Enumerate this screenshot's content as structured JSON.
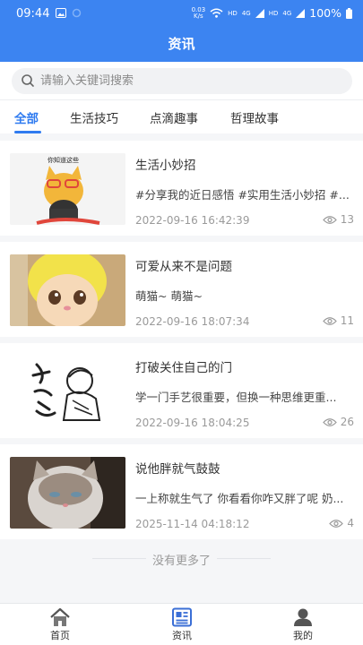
{
  "status_bar": {
    "time": "09:44",
    "speed": "0.03\nK/s",
    "network_a": "HD",
    "network_b": "4G",
    "network_c": "HD",
    "network_d": "4G",
    "battery": "100%"
  },
  "header": {
    "title": "资讯"
  },
  "search": {
    "placeholder": "请输入关键词搜索"
  },
  "tabs": [
    {
      "label": "全部",
      "active": true
    },
    {
      "label": "生活技巧",
      "active": false
    },
    {
      "label": "点滴趣事",
      "active": false
    },
    {
      "label": "哲理故事",
      "active": false
    }
  ],
  "articles": [
    {
      "title": "生活小妙招",
      "description": "#分享我的近日感悟 #实用生活小妙招 #...",
      "date": "2022-09-16 16:42:39",
      "views": "13",
      "thumb_text": "你知道这些"
    },
    {
      "title": "可爱从来不是问题",
      "description": "萌猫~ 萌猫~",
      "date": "2022-09-16 18:07:34",
      "views": "11"
    },
    {
      "title": "打破关住自己的门",
      "description": "学一门手艺很重要，但换一种思维更重...",
      "date": "2022-09-16 18:04:25",
      "views": "26"
    },
    {
      "title": "说他胖就气鼓鼓",
      "description": "一上称就生气了 你看看你咋又胖了呢 奶...",
      "date": "2025-11-14 04:18:12",
      "views": "4"
    }
  ],
  "footer_note": "没有更多了",
  "bottom_nav": [
    {
      "label": "首页",
      "icon": "home-icon"
    },
    {
      "label": "资讯",
      "icon": "news-icon",
      "active": true
    },
    {
      "label": "我的",
      "icon": "user-icon"
    }
  ],
  "colors": {
    "brand_blue": "#3c84f1",
    "active_tab": "#2f7bf0",
    "background": "#f5f6f8"
  }
}
